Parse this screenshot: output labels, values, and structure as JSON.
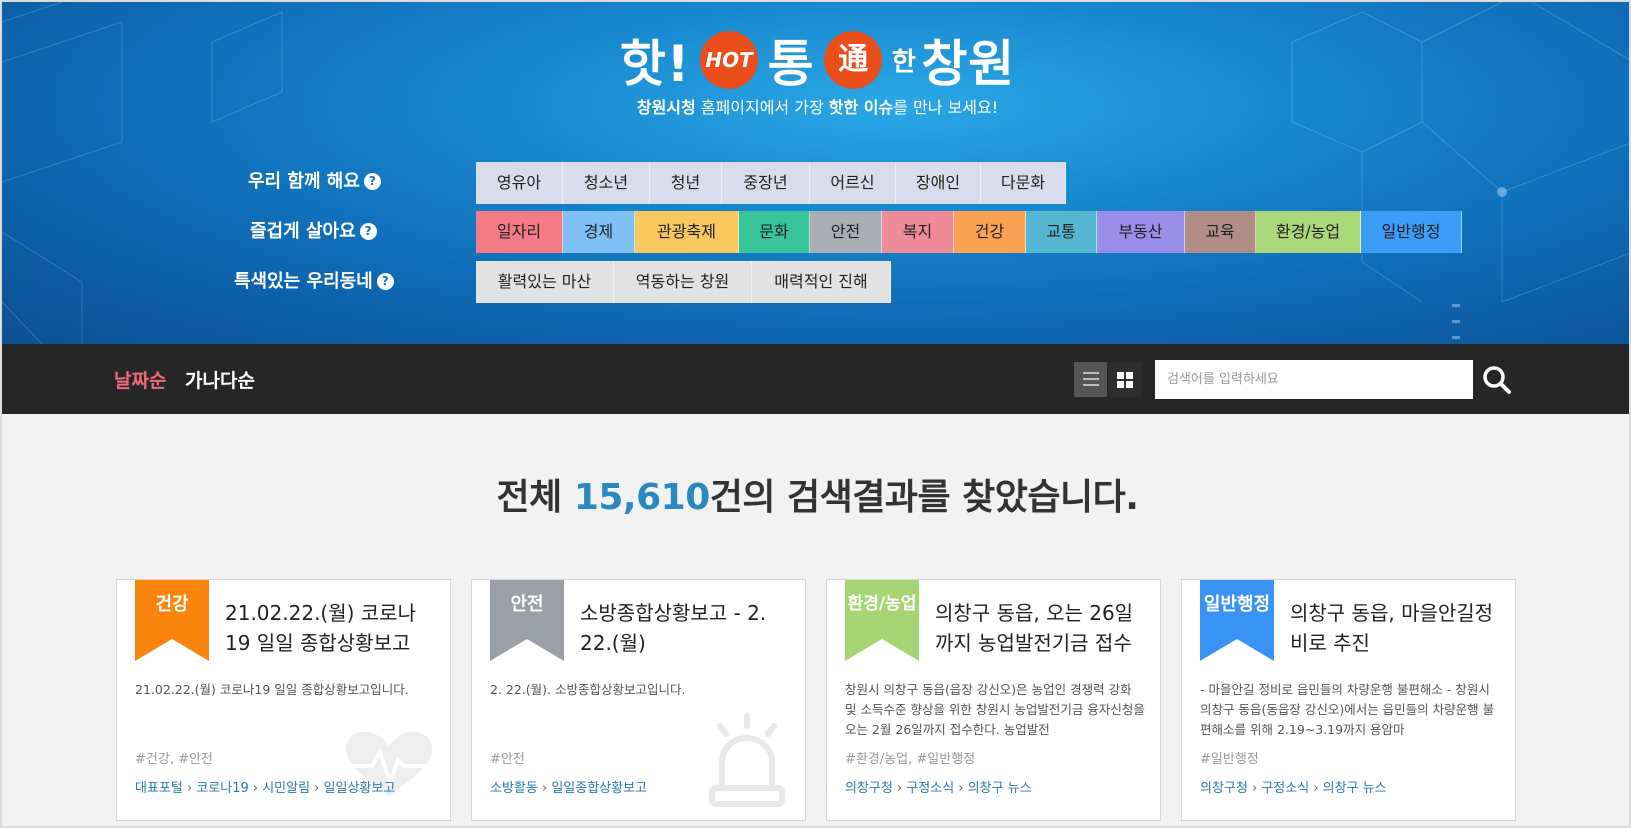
{
  "header": {
    "logo": {
      "t1": "핫!",
      "hot": "HOT",
      "t2": "통",
      "tong": "通",
      "t3": "한",
      "t4": "창원"
    },
    "tagline": {
      "p1": "창원시청",
      "p2": " 홈페이지에서 가장 ",
      "p3": "핫한 이슈",
      "p4": "를 만나 보세요!"
    }
  },
  "categories": [
    {
      "label": "우리 함께 해요",
      "items": [
        {
          "name": "영유아"
        },
        {
          "name": "청소년"
        },
        {
          "name": "청년"
        },
        {
          "name": "중장년"
        },
        {
          "name": "어르신"
        },
        {
          "name": "장애인"
        },
        {
          "name": "다문화"
        }
      ]
    },
    {
      "label": "즐겁게 살아요",
      "items": [
        {
          "name": "일자리",
          "color": "#f47b85"
        },
        {
          "name": "경제",
          "color": "#7fc1f7"
        },
        {
          "name": "관광축제",
          "color": "#f9c85e"
        },
        {
          "name": "문화",
          "color": "#3ac49a"
        },
        {
          "name": "안전",
          "color": "#a9aeb5"
        },
        {
          "name": "복지",
          "color": "#ef8a98"
        },
        {
          "name": "건강",
          "color": "#f9a254"
        },
        {
          "name": "교통",
          "color": "#55b6d1"
        },
        {
          "name": "부동산",
          "color": "#9b8ee8"
        },
        {
          "name": "교육",
          "color": "#b08d86"
        },
        {
          "name": "환경/농업",
          "color": "#a9d77a"
        },
        {
          "name": "일반행정",
          "color": "#3c9cf6"
        }
      ]
    },
    {
      "label": "특색있는 우리동네",
      "items": [
        {
          "name": "활력있는 마산"
        },
        {
          "name": "역동하는 창원"
        },
        {
          "name": "매력적인 진해"
        }
      ]
    }
  ],
  "qmark": "?",
  "toolbar": {
    "sort_date": "날짜순",
    "sort_alpha": "가나다순",
    "search_placeholder": "검색어를 입력하세요"
  },
  "results": {
    "prefix": "전체 ",
    "count": "15,610",
    "suffix": "건의 검색결과를 찾았습니다."
  },
  "cards": [
    {
      "badge": "건강",
      "badge_color": "#f9850f",
      "title": "21.02.22.(월) 코로나19 일일 종합상황보고",
      "desc": "21.02.22.(월) 코로나19 일일 종합상황보고입니다.",
      "tags": "#건강, #안전",
      "path": [
        "대표포털",
        "코로나19",
        "시민알림",
        "일일상황보고"
      ],
      "icon": "heart-pulse-icon"
    },
    {
      "badge": "안전",
      "badge_color": "#9aa0a6",
      "title": "소방종합상황보고 - 2. 22.(월)",
      "desc": "2. 22.(월). 소방종합상황보고입니다.",
      "tags": "#안전",
      "path": [
        "소방활동",
        "일일종합상황보고"
      ],
      "icon": "siren-icon"
    },
    {
      "badge": "환경/농업",
      "badge_color": "#a6d673",
      "title": "의창구 동읍, 오는 26일까지 농업발전기금 접수",
      "desc": "창원시 의창구 동읍(읍장 강신오)은 농업인 경쟁력 강화 및 소득수준 향상을 위한 창원시 농업발전기금 융자신청을 오는 2월 26일까지 접수한다. 농업발전",
      "tags": "#환경/농업, #일반행정",
      "path": [
        "의창구청",
        "구정소식",
        "의창구 뉴스"
      ]
    },
    {
      "badge": "일반행정",
      "badge_color": "#3993f5",
      "title": "의창구 동읍, 마을안길정비로 추진",
      "desc": "- 마을안길 정비로 읍민들의 차량운행 불편해소 - 창원시 의창구 동읍(동읍장 강신오)에서는 읍민들의 차량운행 불편해소를 위해 2.19~3.19까지 용암마",
      "tags": "#일반행정",
      "path": [
        "의창구청",
        "구정소식",
        "의창구 뉴스"
      ]
    }
  ]
}
